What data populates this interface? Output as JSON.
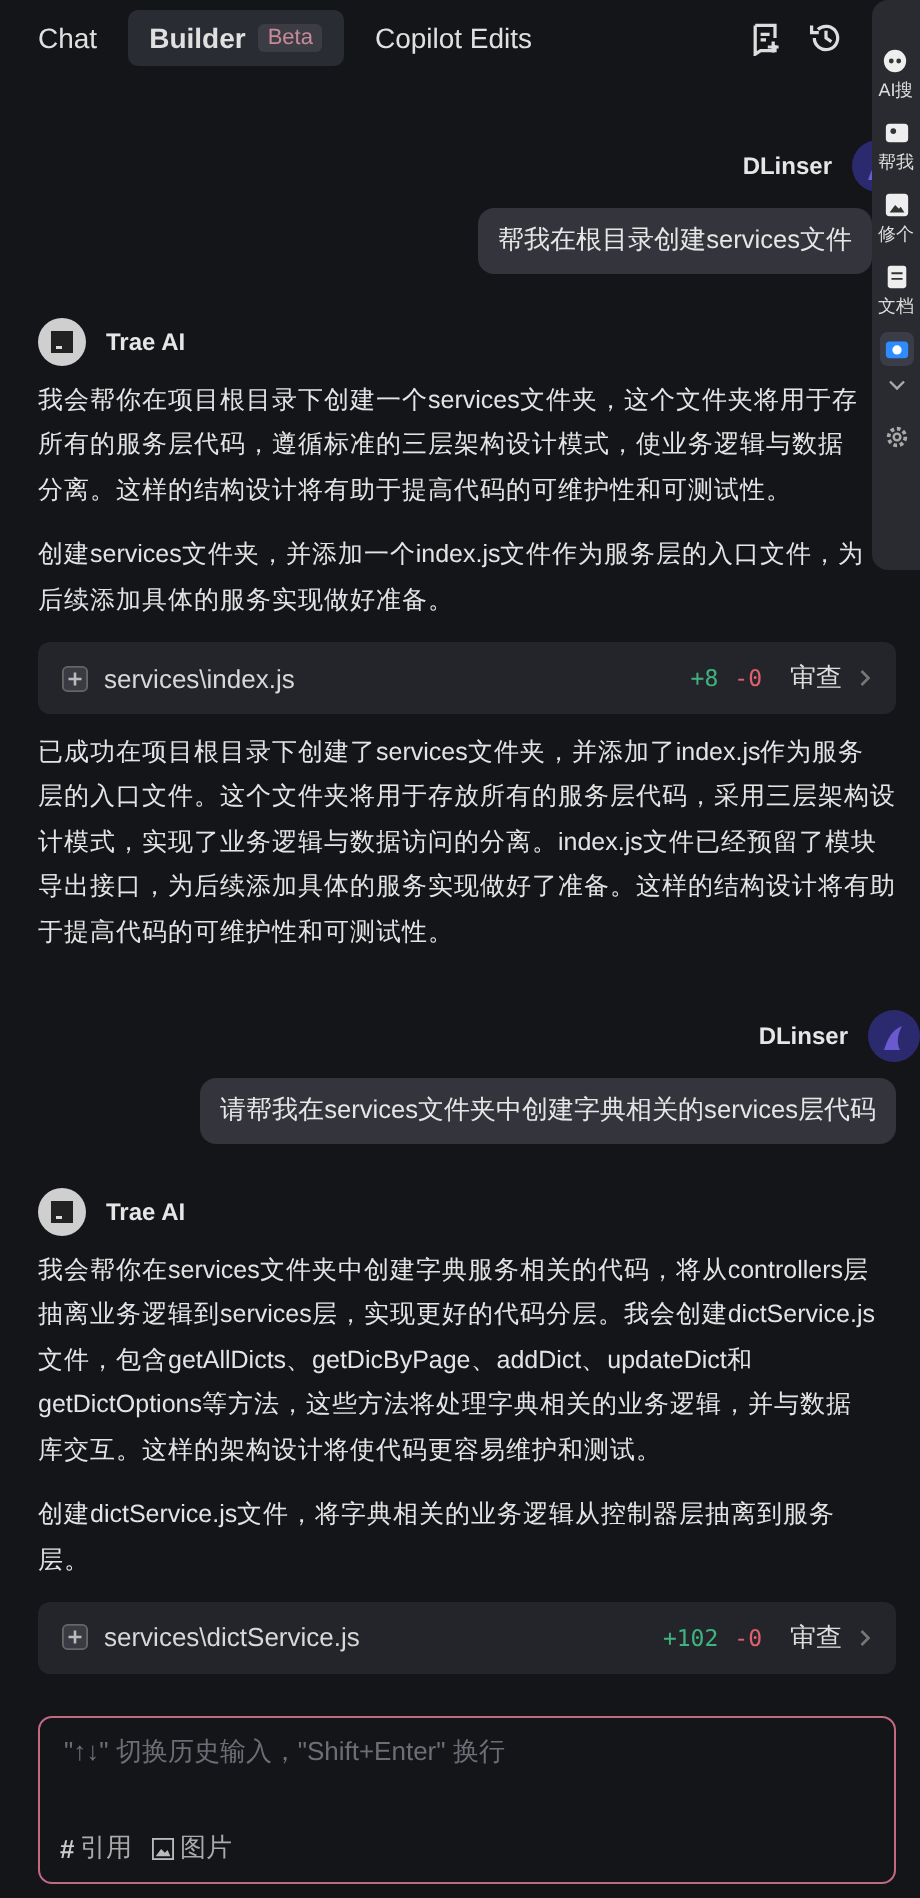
{
  "tabs": [
    {
      "label": "Chat",
      "selected": false
    },
    {
      "label": "Builder",
      "badge": "Beta",
      "selected": true
    },
    {
      "label": "Copilot Edits",
      "selected": false
    }
  ],
  "messages": [
    {
      "kind": "user",
      "name": "DLinser",
      "text": "帮我在根目录创建services文件"
    },
    {
      "kind": "ai",
      "name": "Trae AI",
      "blocks": [
        {
          "kind": "para",
          "lines": [
            "我会帮你在项目根目录下创建一个services文件夹，这个文件夹将用于存",
            "所有的服务层代码，遵循标准的三层架构设计模式，使业务逻辑与数据",
            "分离。这样的结构设计将有助于提高代码的可维护性和可测试性。"
          ]
        },
        {
          "kind": "para",
          "lines": [
            "创建services文件夹，并添加一个index.js文件作为服务层的入口文件，为",
            "后续添加具体的服务实现做好准备。"
          ]
        },
        {
          "kind": "file",
          "path": "services\\index.js",
          "added": "+8",
          "removed": "-0",
          "action": "审查"
        },
        {
          "kind": "para",
          "lines": [
            "已成功在项目根目录下创建了services文件夹，并添加了index.js作为服务",
            "层的入口文件。这个文件夹将用于存放所有的服务层代码，采用三层架构设",
            "计模式，实现了业务逻辑与数据访问的分离。index.js文件已经预留了模块",
            "导出接口，为后续添加具体的服务实现做好了准备。这样的结构设计将有助",
            "于提高代码的可维护性和可测试性。"
          ]
        }
      ]
    },
    {
      "kind": "user",
      "name": "DLinser",
      "text": "请帮我在services文件夹中创建字典相关的services层代码"
    },
    {
      "kind": "ai",
      "name": "Trae AI",
      "blocks": [
        {
          "kind": "para",
          "lines": [
            "我会帮你在services文件夹中创建字典服务相关的代码，将从controllers层",
            "抽离业务逻辑到services层，实现更好的代码分层。我会创建dictService.js",
            "文件，包含getAllDicts、getDicByPage、addDict、updateDict和",
            "getDictOptions等方法，这些方法将处理字典相关的业务逻辑，并与数据",
            "库交互。这样的架构设计将使代码更容易维护和测试。"
          ]
        },
        {
          "kind": "para",
          "lines": [
            "创建dictService.js文件，将字典相关的业务逻辑从控制器层抽离到服务",
            "层。"
          ]
        },
        {
          "kind": "file",
          "path": "services\\dictService.js",
          "added": "+102",
          "removed": "-0",
          "action": "审查"
        }
      ]
    }
  ],
  "input": {
    "placeholder": "\"↑↓\" 切换历史输入，\"Shift+Enter\" 换行",
    "tools": [
      {
        "kind": "hash",
        "icon": "#",
        "label": "引用"
      },
      {
        "kind": "image",
        "label": "图片"
      }
    ]
  },
  "side_panel": [
    {
      "kind": "robot",
      "label": "AI搜"
    },
    {
      "kind": "tag",
      "label": "帮我"
    },
    {
      "kind": "image",
      "label": "修个"
    },
    {
      "kind": "doc",
      "label": "文档"
    },
    {
      "kind": "camera",
      "selected": true
    }
  ]
}
